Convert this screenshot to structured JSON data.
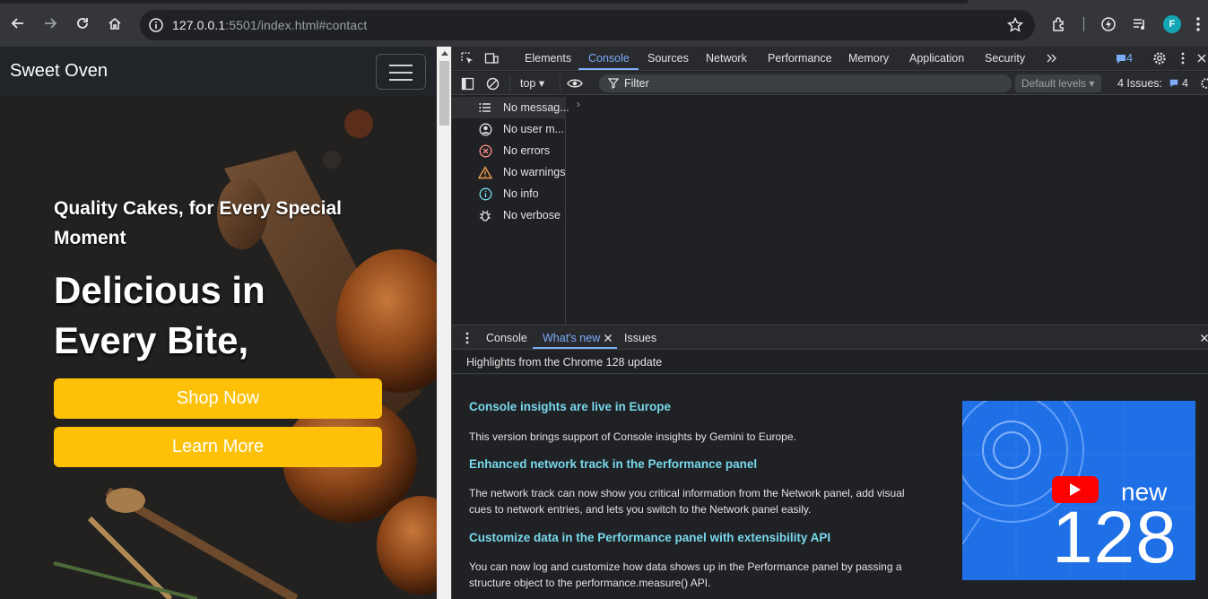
{
  "browser": {
    "url_host": "127.0.0.1",
    "url_rest": ":5501/index.html#contact",
    "profile_initial": "F"
  },
  "site": {
    "brand": "Sweet Oven",
    "hero_subtitle": "Quality Cakes, for Every Special Moment",
    "hero_title_line1": "Delicious in",
    "hero_title_line2": "Every Bite,",
    "shop_button": "Shop Now",
    "learn_button": "Learn More"
  },
  "devtools": {
    "tabs": [
      "Elements",
      "Console",
      "Sources",
      "Network",
      "Performance",
      "Memory",
      "Application",
      "Security"
    ],
    "active_tab": "Console",
    "issue_badge": "4",
    "context": "top",
    "filter_placeholder": "Filter",
    "levels_label": "Default levels",
    "issues_summary": "4 Issues:",
    "issues_summary_count": "4",
    "sidebar": [
      {
        "label": "No messag...",
        "icon": "list-icon"
      },
      {
        "label": "No user m...",
        "icon": "user-icon"
      },
      {
        "label": "No errors",
        "icon": "error-icon"
      },
      {
        "label": "No warnings",
        "icon": "warning-icon"
      },
      {
        "label": "No info",
        "icon": "info-icon"
      },
      {
        "label": "No verbose",
        "icon": "bug-icon"
      }
    ],
    "drawer_tabs": [
      "Console",
      "What's new",
      "Issues"
    ],
    "drawer_active": "What's new",
    "highlights": "Highlights from the Chrome 128 update",
    "whats_new": [
      {
        "title": "Console insights are live in Europe",
        "body": "This version brings support of Console insights by Gemini to Europe."
      },
      {
        "title": "Enhanced network track in the Performance panel",
        "body": "The network track can now show you critical information from the Network panel, add visual cues to network entries, and lets you switch to the Network panel easily."
      },
      {
        "title": "Customize data in the Performance panel with extensibility API",
        "body": "You can now log and customize how data shows up in the Performance panel by passing a structure object to the performance.measure() API."
      }
    ],
    "promo_new": "new",
    "promo_version": "128"
  },
  "colors": {
    "accent_blue": "#7cacf8",
    "heading_cyan": "#78d9ec",
    "button_yellow": "#ffc107",
    "promo_blue": "#1f6fe6"
  }
}
